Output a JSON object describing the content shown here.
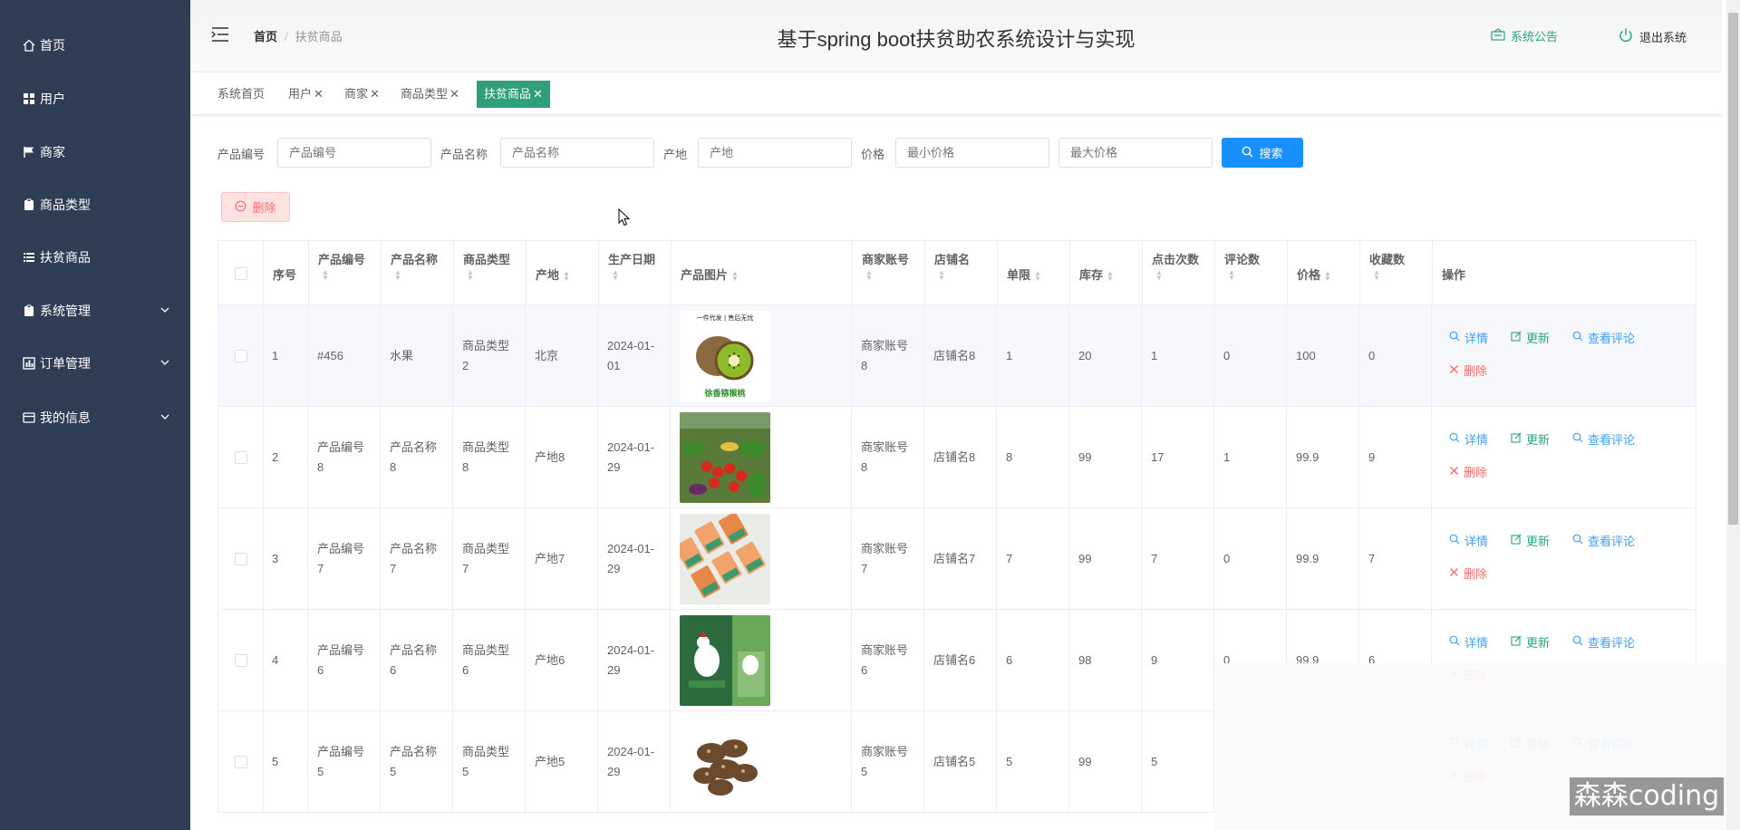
{
  "sidebar": {
    "items": [
      {
        "label": "首页",
        "icon": "home-icon"
      },
      {
        "label": "用户",
        "icon": "grid-icon"
      },
      {
        "label": "商家",
        "icon": "flag-icon"
      },
      {
        "label": "商品类型",
        "icon": "clipboard-icon"
      },
      {
        "label": "扶贫商品",
        "icon": "list-icon"
      },
      {
        "label": "系统管理",
        "icon": "clipboard-icon"
      },
      {
        "label": "订单管理",
        "icon": "chart-icon"
      },
      {
        "label": "我的信息",
        "icon": "card-icon"
      }
    ]
  },
  "header": {
    "breadcrumb_home": "首页",
    "breadcrumb_current": "扶贫商品",
    "title": "基于spring boot扶贫助农系统设计与实现",
    "notice": "系统公告",
    "logout": "退出系统"
  },
  "tabs": [
    {
      "label": "系统首页",
      "closable": false
    },
    {
      "label": "用户",
      "closable": true
    },
    {
      "label": "商家",
      "closable": true
    },
    {
      "label": "商品类型",
      "closable": true
    },
    {
      "label": "扶贫商品",
      "closable": true,
      "active": true
    }
  ],
  "search": {
    "code_label": "产品编号",
    "code_placeholder": "产品编号",
    "name_label": "产品名称",
    "name_placeholder": "产品名称",
    "origin_label": "产地",
    "origin_placeholder": "产地",
    "price_label": "价格",
    "min_placeholder": "最小价格",
    "max_placeholder": "最大价格",
    "button": "搜索"
  },
  "delete_button": "删除",
  "table": {
    "headers": [
      "序号",
      "产品编号",
      "产品名称",
      "商品类型",
      "产地",
      "生产日期",
      "产品图片",
      "商家账号",
      "店铺名",
      "单限",
      "库存",
      "点击次数",
      "评论数",
      "价格",
      "收藏数",
      "操作"
    ],
    "rows": [
      {
        "idx": "1",
        "code": "#456",
        "name": "水果",
        "type": "商品类型2",
        "origin": "北京",
        "date": "2024-01-01",
        "merchant": "商家账号8",
        "shop": "店铺名8",
        "limit": "1",
        "stock": "20",
        "clicks": "1",
        "comments": "0",
        "price": "100",
        "favs": "0",
        "image": "kiwi",
        "img_text_top": "一件代发 | 售后无忧",
        "img_text_bottom": "徐香猕猴桃"
      },
      {
        "idx": "2",
        "code": "产品编号8",
        "name": "产品名称8",
        "type": "商品类型8",
        "origin": "产地8",
        "date": "2024-01-29",
        "merchant": "商家账号8",
        "shop": "店铺名8",
        "limit": "8",
        "stock": "99",
        "clicks": "17",
        "comments": "1",
        "price": "99.9",
        "favs": "9",
        "image": "vegetables"
      },
      {
        "idx": "3",
        "code": "产品编号7",
        "name": "产品名称7",
        "type": "商品类型7",
        "origin": "产地7",
        "date": "2024-01-29",
        "merchant": "商家账号7",
        "shop": "店铺名7",
        "limit": "7",
        "stock": "99",
        "clicks": "7",
        "comments": "0",
        "price": "99.9",
        "favs": "7",
        "image": "packs"
      },
      {
        "idx": "4",
        "code": "产品编号6",
        "name": "产品名称6",
        "type": "商品类型6",
        "origin": "产地6",
        "date": "2024-01-29",
        "merchant": "商家账号6",
        "shop": "店铺名6",
        "limit": "6",
        "stock": "98",
        "clicks": "9",
        "comments": "0",
        "price": "99.9",
        "favs": "6",
        "image": "chicken"
      },
      {
        "idx": "5",
        "code": "产品编号5",
        "name": "产品名称5",
        "type": "商品类型5",
        "origin": "产地5",
        "date": "2024-01-29",
        "merchant": "商家账号5",
        "shop": "店铺名5",
        "limit": "5",
        "stock": "99",
        "clicks": "5",
        "comments": "",
        "price": "",
        "favs": "",
        "image": "mushroom"
      }
    ],
    "ops": {
      "detail": "详情",
      "update": "更新",
      "comments": "查看评论",
      "delete": "删除"
    }
  },
  "watermark": "森森coding",
  "colors": {
    "sidebar": "#2f3e55",
    "accent": "#2e9f78",
    "primary": "#1890ff",
    "danger": "#f56c6c"
  }
}
